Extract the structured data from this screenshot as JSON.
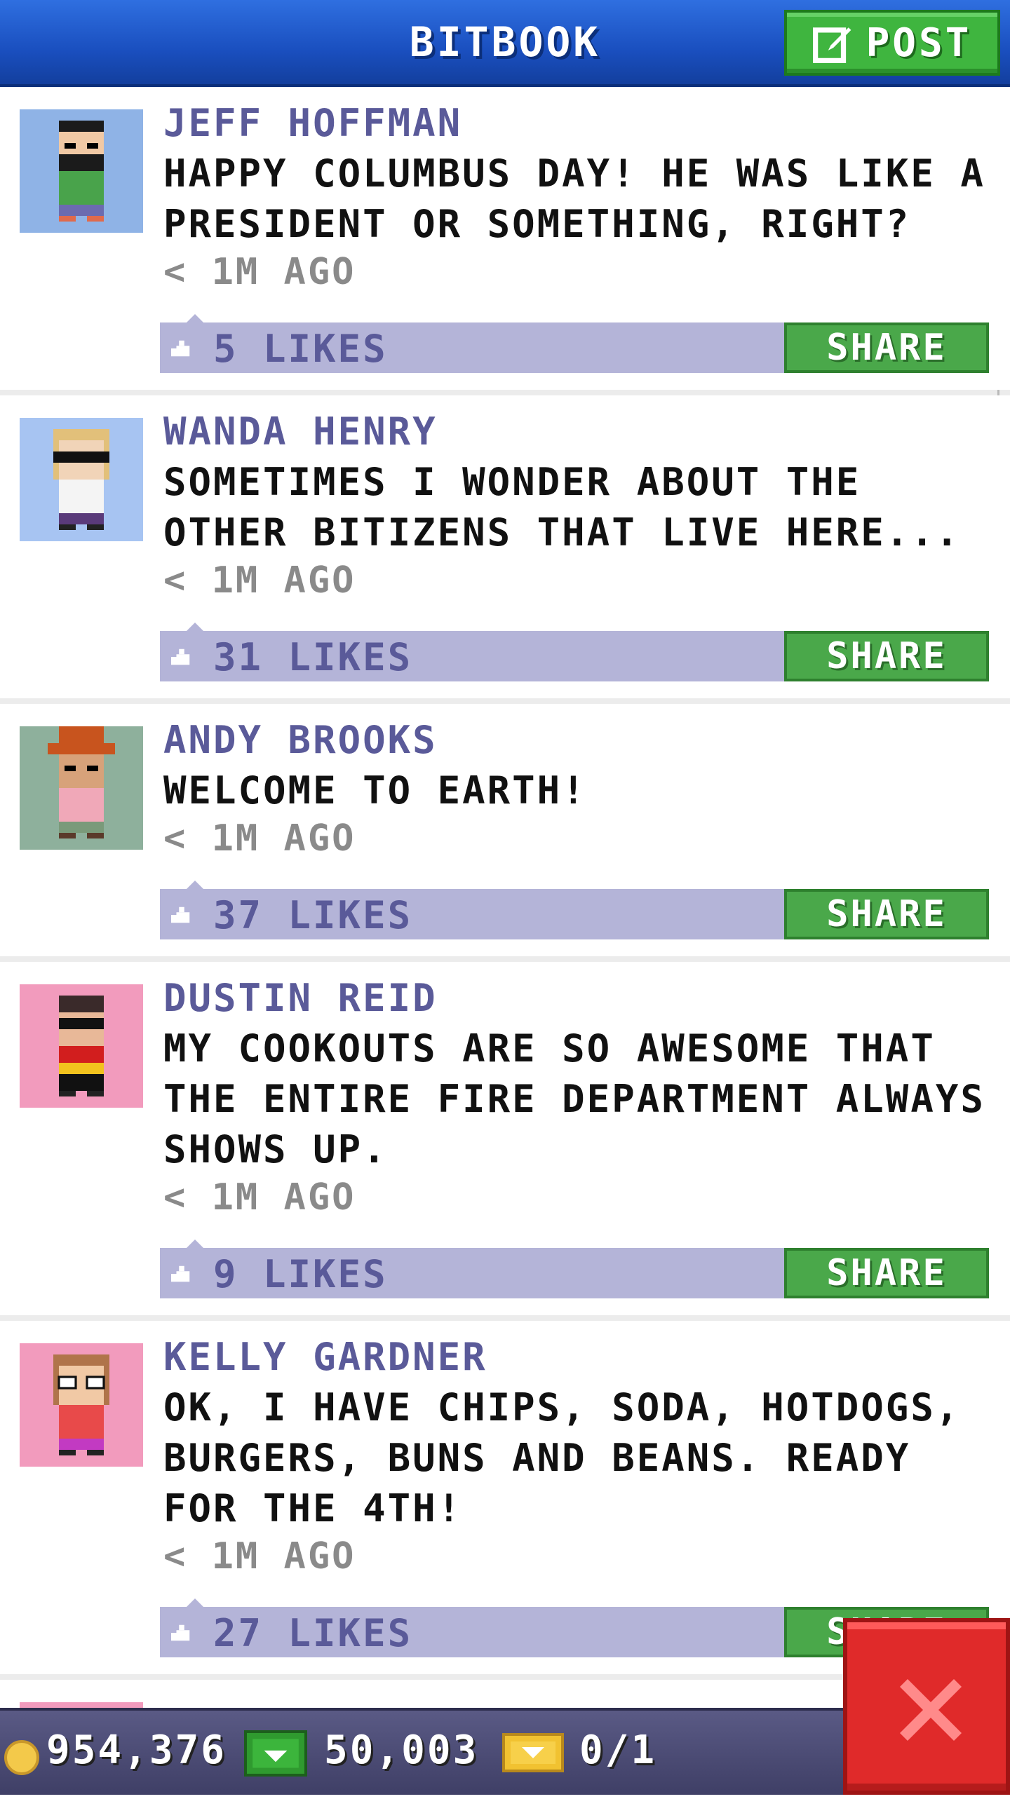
{
  "header": {
    "title": "BITBOOK",
    "post_label": "POST",
    "post_icon": "edit-icon"
  },
  "posts": [
    {
      "name": "JEFF HOFFMAN",
      "text": "HAPPY COLUMBUS DAY! HE WAS LIKE A PRESIDENT OR SOMETHING, RIGHT?",
      "time": "< 1M AGO",
      "likes": "5 LIKES",
      "share": "SHARE",
      "avatar_bg": "#8fb3e6"
    },
    {
      "name": "WANDA HENRY",
      "text": "SOMETIMES I WONDER ABOUT THE OTHER BITIZENS THAT LIVE HERE...",
      "time": "< 1M AGO",
      "likes": "31 LIKES",
      "share": "SHARE",
      "avatar_bg": "#a7c4f2"
    },
    {
      "name": "ANDY BROOKS",
      "text": "WELCOME TO EARTH!",
      "time": "< 1M AGO",
      "likes": "37 LIKES",
      "share": "SHARE",
      "avatar_bg": "#8eb09c"
    },
    {
      "name": "DUSTIN REID",
      "text": "MY COOKOUTS ARE SO AWESOME THAT THE ENTIRE FIRE DEPARTMENT ALWAYS SHOWS UP.",
      "time": "< 1M AGO",
      "likes": "9 LIKES",
      "share": "SHARE",
      "avatar_bg": "#f29bbd"
    },
    {
      "name": "KELLY GARDNER",
      "text": "OK, I HAVE CHIPS, SODA, HOTDOGS, BURGERS, BUNS AND BEANS. READY FOR THE 4TH!",
      "time": "< 1M AGO",
      "likes": "27 LIKES",
      "share": "SHARE",
      "avatar_bg": "#f29bbd"
    }
  ],
  "bottom_bar": {
    "coins": "954,376",
    "bux": "50,003",
    "tickets": "0/1",
    "coin_icon": "coin-icon",
    "bux_icon": "cash-icon",
    "ticket_icon": "ticket-icon"
  },
  "close_icon": "close-icon"
}
